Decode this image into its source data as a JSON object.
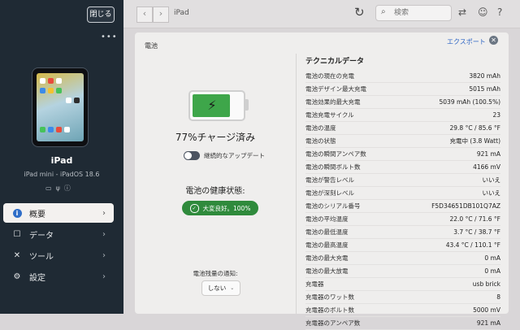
{
  "sidebar": {
    "close_label": "閉じる",
    "more_label": "•••",
    "device_name": "iPad",
    "device_subtitle": "iPad mini - iPadOS 18.6",
    "status_icons": [
      "battery-icon",
      "usb-icon",
      "info-icon"
    ],
    "nav": [
      {
        "label": "概要",
        "icon": "info-icon",
        "active": true
      },
      {
        "label": "データ",
        "icon": "checkbox-icon",
        "active": false
      },
      {
        "label": "ツール",
        "icon": "tools-icon",
        "active": false
      },
      {
        "label": "設定",
        "icon": "gear-icon",
        "active": false
      }
    ]
  },
  "topbar": {
    "back_glyph": "‹",
    "forward_glyph": "›",
    "breadcrumb": "iPad",
    "search_placeholder": "検索"
  },
  "panel": {
    "title": "電池",
    "export_label": "エクスポート",
    "battery_level_percent": 77,
    "charge_text": "77%チャージ済み",
    "continuous_update_label": "継続的なアップデート",
    "continuous_update_on": false,
    "health_title": "電池の健康状態:",
    "health_badge": "大変良好。100%",
    "notify_label": "電池残量の通知:",
    "notify_value": "しない",
    "colors": {
      "health": "#2f8a3c",
      "battery_fill": "#3ea64a",
      "accent": "#2f66c5"
    }
  },
  "tech": {
    "title": "テクニカルデータ",
    "rows": [
      {
        "key": "電池の現在の充電",
        "value": "3820 mAh"
      },
      {
        "key": "電池デザイン最大充電",
        "value": "5015 mAh"
      },
      {
        "key": "電池効果的最大充電",
        "value": "5039 mAh (100.5%)"
      },
      {
        "key": "電池充電サイクル",
        "value": "23"
      },
      {
        "key": "電池の温度",
        "value": "29.8 °C / 85.6 °F"
      },
      {
        "key": "電池の状態",
        "value": "充電中 (3.8 Watt)"
      },
      {
        "key": "電池の瞬間アンペア数",
        "value": "921 mA"
      },
      {
        "key": "電池の瞬間ボルト数",
        "value": "4166 mV"
      },
      {
        "key": "電池が警告レベル",
        "value": "いいえ"
      },
      {
        "key": "電池が深刻レベル",
        "value": "いいえ"
      },
      {
        "key": "電池のシリアル番号",
        "value": "F5D34651DB101Q7AZ"
      },
      {
        "key": "電池の平均温度",
        "value": "22.0 °C / 71.6 °F"
      },
      {
        "key": "電池の最低温度",
        "value": "3.7 °C / 38.7 °F"
      },
      {
        "key": "電池の最高温度",
        "value": "43.4 °C / 110.1 °F"
      },
      {
        "key": "電池の最大充電",
        "value": "0 mA"
      },
      {
        "key": "電池の最大放電",
        "value": "0 mA"
      },
      {
        "key": "充電器",
        "value": "usb brick"
      },
      {
        "key": "充電器のワット数",
        "value": "8"
      },
      {
        "key": "充電器のボルト数",
        "value": "5000 mV"
      },
      {
        "key": "充電器のアンペア数",
        "value": "921 mA"
      }
    ]
  }
}
